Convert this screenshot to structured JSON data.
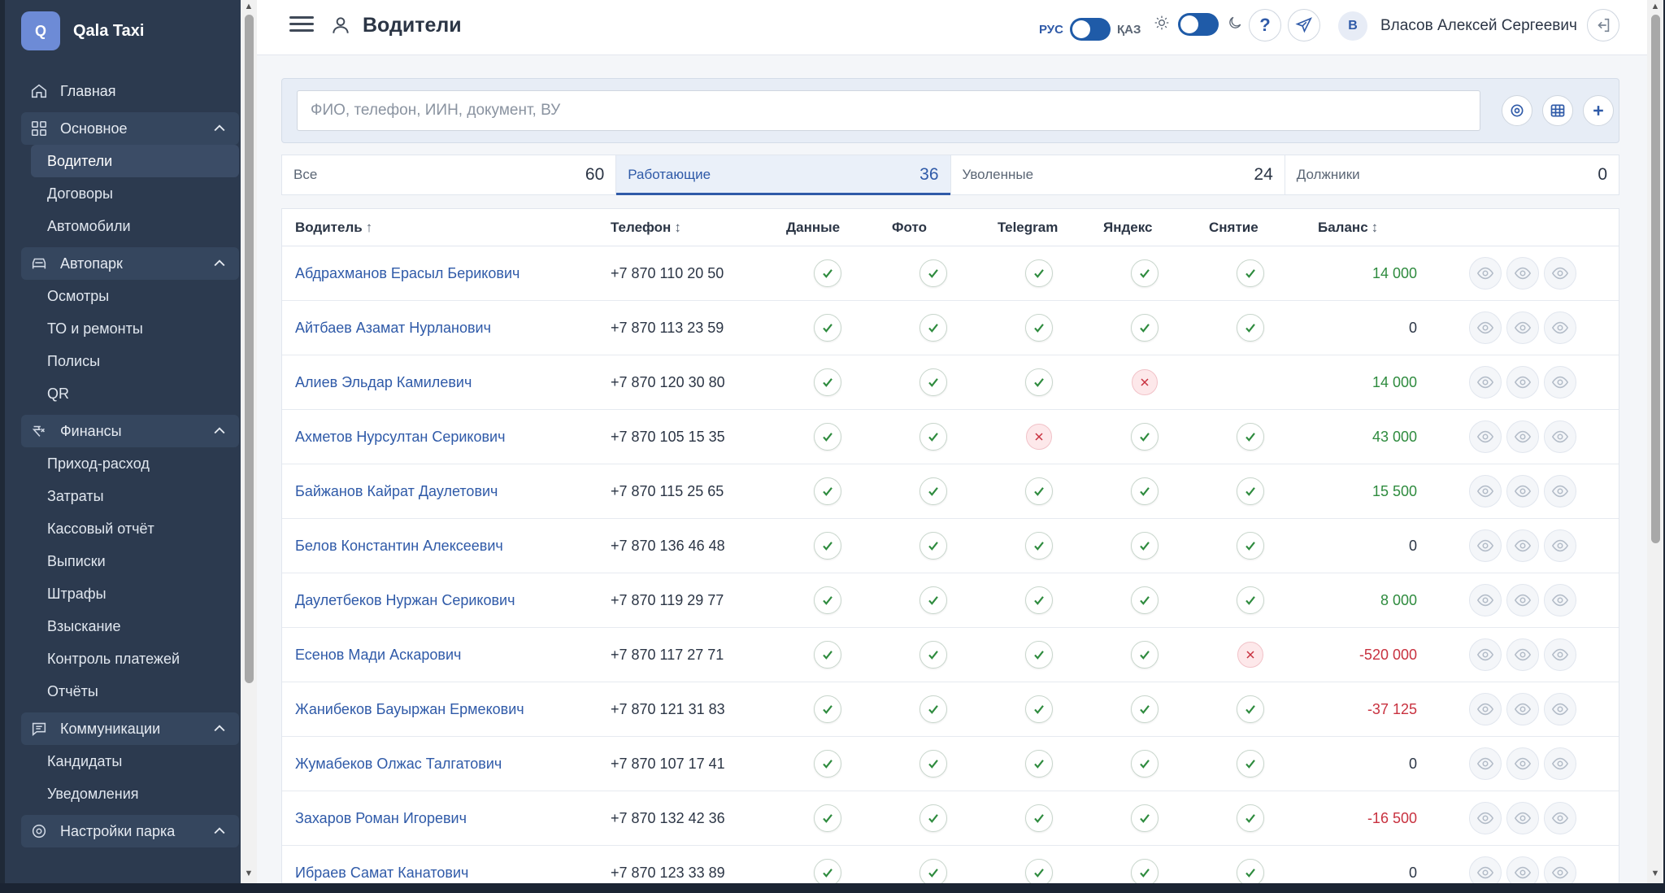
{
  "app": {
    "logo_letter": "Q",
    "name": "Qala Taxi"
  },
  "sidebar": {
    "home": "Главная",
    "sections": [
      {
        "label": "Основное",
        "items": [
          "Водители",
          "Договоры",
          "Автомобили"
        ]
      },
      {
        "label": "Автопарк",
        "items": [
          "Осмотры",
          "ТО и ремонты",
          "Полисы",
          "QR"
        ]
      },
      {
        "label": "Финансы",
        "items": [
          "Приход-расход",
          "Затраты",
          "Кассовый отчёт",
          "Выписки",
          "Штрафы",
          "Взыскание",
          "Контроль платежей",
          "Отчёты"
        ]
      },
      {
        "label": "Коммуникации",
        "items": [
          "Кандидаты",
          "Уведомления"
        ]
      },
      {
        "label": "Настройки парка",
        "items": []
      }
    ],
    "active_item": "Водители"
  },
  "topbar": {
    "page_title": "Водители",
    "lang_left": "РУС",
    "lang_right": "ҚАЗ",
    "help_label": "?",
    "avatar_letter": "В",
    "user_name": "Власов Алексей Сергеевич"
  },
  "search": {
    "placeholder": "ФИО, телефон, ИИН, документ, ВУ",
    "value": ""
  },
  "tabs": [
    {
      "label": "Все",
      "count": "60"
    },
    {
      "label": "Работающие",
      "count": "36"
    },
    {
      "label": "Уволенные",
      "count": "24"
    },
    {
      "label": "Должники",
      "count": "0"
    }
  ],
  "active_tab": "Работающие",
  "table": {
    "headers": {
      "name": "Водитель",
      "phone": "Телефон",
      "data": "Данные",
      "photo": "Фото",
      "telegram": "Telegram",
      "yandex": "Яндекс",
      "withdraw": "Снятие",
      "balance": "Баланс"
    },
    "sort_indicators": {
      "name": "↑",
      "phone": "↕",
      "balance": "↕"
    },
    "rows": [
      {
        "name": "Абдрахманов Ерасыл Берикович",
        "phone": "+7 870 110 20 50",
        "data": "ok",
        "photo": "ok",
        "telegram": "ok",
        "yandex": "ok",
        "withdraw": "ok",
        "balance": "14 000",
        "sign": "pos"
      },
      {
        "name": "Айтбаев Азамат Нурланович",
        "phone": "+7 870 113 23 59",
        "data": "ok",
        "photo": "ok",
        "telegram": "ok",
        "yandex": "ok",
        "withdraw": "ok",
        "balance": "0",
        "sign": "zero"
      },
      {
        "name": "Алиев Эльдар Камилевич",
        "phone": "+7 870 120 30 80",
        "data": "ok",
        "photo": "ok",
        "telegram": "ok",
        "yandex": "no",
        "withdraw": "none",
        "balance": "14 000",
        "sign": "pos"
      },
      {
        "name": "Ахметов Нурсултан Серикович",
        "phone": "+7 870 105 15 35",
        "data": "ok",
        "photo": "ok",
        "telegram": "no",
        "yandex": "ok",
        "withdraw": "ok",
        "balance": "43 000",
        "sign": "pos"
      },
      {
        "name": "Байжанов Кайрат Даулетович",
        "phone": "+7 870 115 25 65",
        "data": "ok",
        "photo": "ok",
        "telegram": "ok",
        "yandex": "ok",
        "withdraw": "ok",
        "balance": "15 500",
        "sign": "pos"
      },
      {
        "name": "Белов Константин Алексеевич",
        "phone": "+7 870 136 46 48",
        "data": "ok",
        "photo": "ok",
        "telegram": "ok",
        "yandex": "ok",
        "withdraw": "ok",
        "balance": "0",
        "sign": "zero"
      },
      {
        "name": "Даулетбеков Нуржан Серикович",
        "phone": "+7 870 119 29 77",
        "data": "ok",
        "photo": "ok",
        "telegram": "ok",
        "yandex": "ok",
        "withdraw": "ok",
        "balance": "8 000",
        "sign": "pos"
      },
      {
        "name": "Есенов Мади Аскарович",
        "phone": "+7 870 117 27 71",
        "data": "ok",
        "photo": "ok",
        "telegram": "ok",
        "yandex": "ok",
        "withdraw": "no",
        "balance": "-520 000",
        "sign": "neg"
      },
      {
        "name": "Жанибеков Бауыржан Ермекович",
        "phone": "+7 870 121 31 83",
        "data": "ok",
        "photo": "ok",
        "telegram": "ok",
        "yandex": "ok",
        "withdraw": "ok",
        "balance": "-37 125",
        "sign": "neg"
      },
      {
        "name": "Жумабеков Олжас Талгатович",
        "phone": "+7 870 107 17 41",
        "data": "ok",
        "photo": "ok",
        "telegram": "ok",
        "yandex": "ok",
        "withdraw": "ok",
        "balance": "0",
        "sign": "zero"
      },
      {
        "name": "Захаров Роман Игоревич",
        "phone": "+7 870 132 42 36",
        "data": "ok",
        "photo": "ok",
        "telegram": "ok",
        "yandex": "ok",
        "withdraw": "ok",
        "balance": "-16 500",
        "sign": "neg"
      },
      {
        "name": "Ибраев Самат Канатович",
        "phone": "+7 870 123 33 89",
        "data": "ok",
        "photo": "ok",
        "telegram": "ok",
        "yandex": "ok",
        "withdraw": "ok",
        "balance": "0",
        "sign": "zero"
      }
    ]
  },
  "colors": {
    "sidebar": "#2c3a4f",
    "accent": "#2f5aa8",
    "positive": "#2e8b3e",
    "negative": "#c8313f"
  }
}
